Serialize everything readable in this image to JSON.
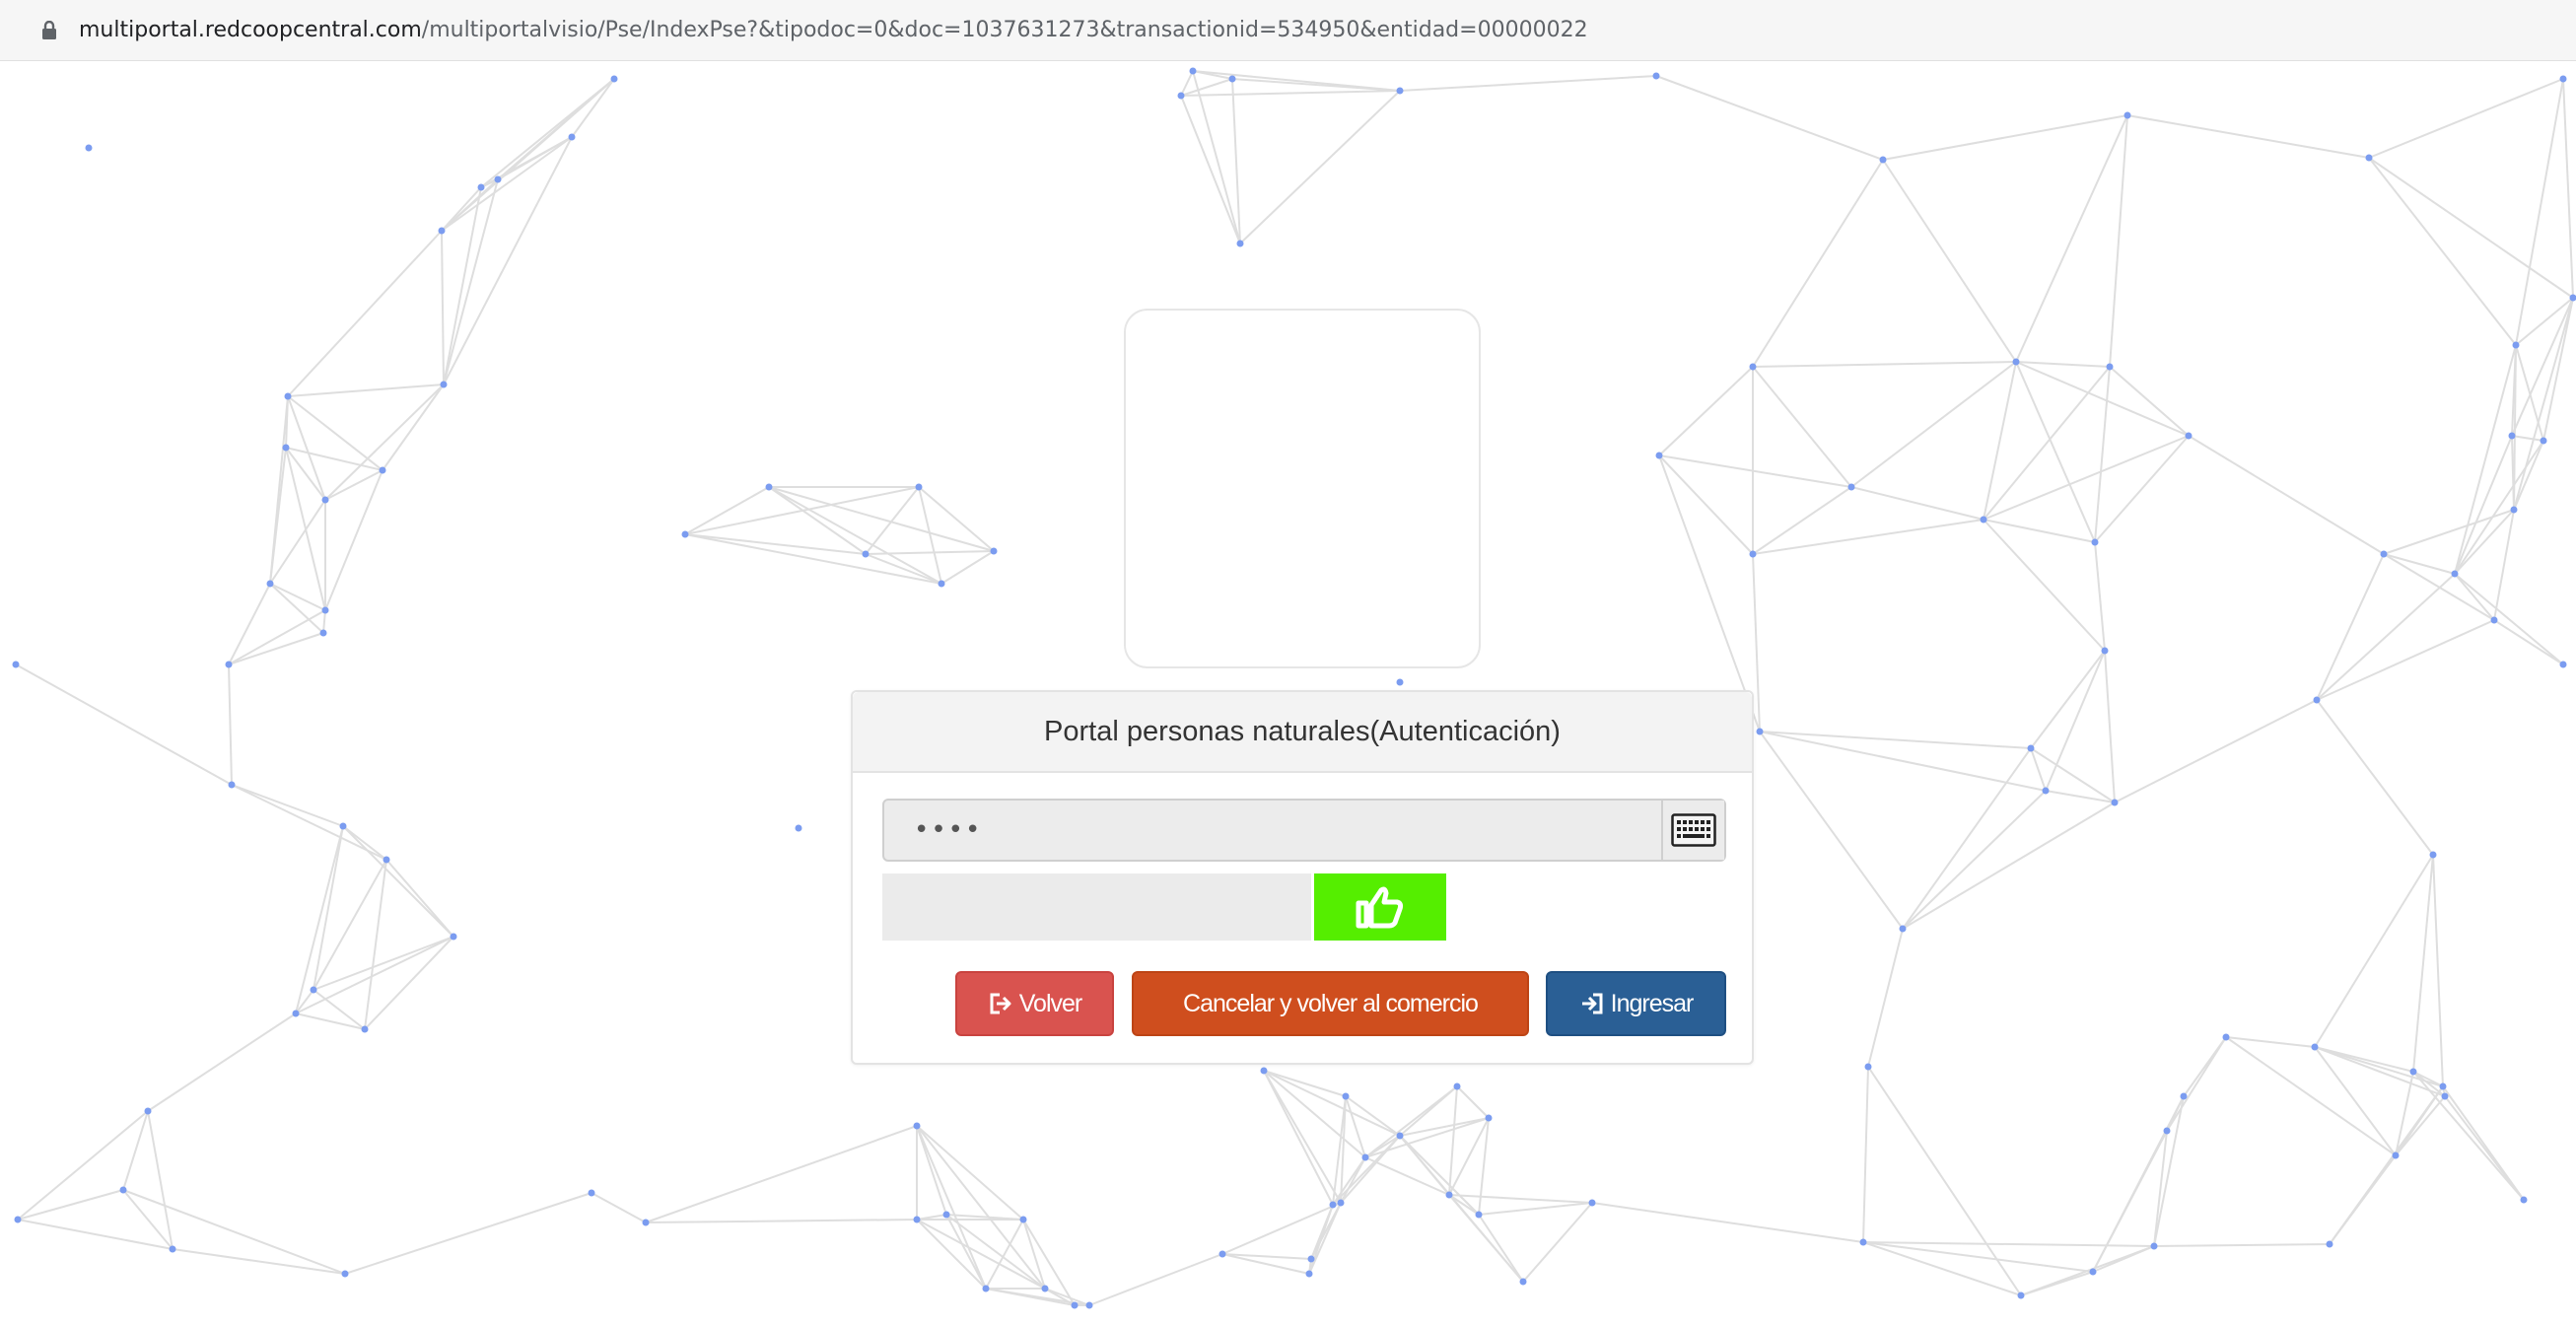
{
  "browser": {
    "lock_icon": "lock-icon",
    "url_host": "multiportal.redcoopcentral.com",
    "url_path": "/multiportalvisio/Pse/IndexPse?&tipodoc=0&doc=1037631273&transactionid=534950&entidad=00000022"
  },
  "auth_panel": {
    "title": "Portal personas naturales(Autenticación)",
    "password_value": "••••",
    "keyboard_icon": "keyboard-icon",
    "thumbs_icon": "thumbs-up-icon"
  },
  "buttons": {
    "volver": "Volver",
    "cancelar": "Cancelar y volver al comercio",
    "ingresar": "Ingresar"
  },
  "colors": {
    "volver": "#d9534f",
    "cancelar": "#cf4e1e",
    "ingresar": "#2a5f95",
    "thumbs_bg": "#55ee00",
    "network_node": "#7b9cf0",
    "network_edge": "#dedede"
  }
}
